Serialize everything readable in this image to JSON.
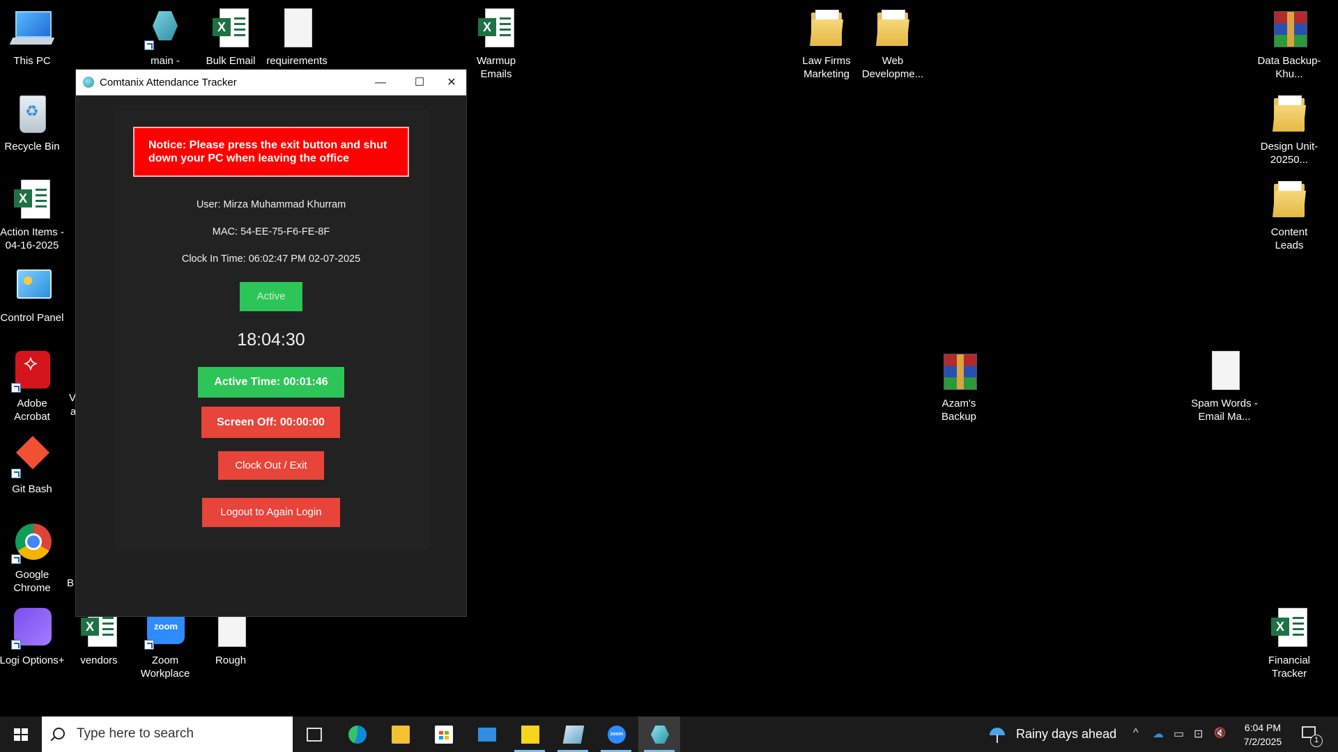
{
  "desktop": {
    "icons": [
      {
        "label": "This PC",
        "icon": "computer-icon"
      },
      {
        "label": "Recycle Bin",
        "icon": "recycle-bin-icon"
      },
      {
        "label": "Action Items - 04-16-2025",
        "icon": "excel-file-icon"
      },
      {
        "label": "Control Panel",
        "icon": "control-panel-icon"
      },
      {
        "label": "Adobe Acrobat",
        "icon": "acrobat-icon"
      },
      {
        "label": "Git Bash",
        "icon": "git-icon"
      },
      {
        "label": "Google Chrome",
        "icon": "chrome-icon"
      },
      {
        "label": "Logi Options+",
        "icon": "logi-icon"
      },
      {
        "label": "main - Shortcut",
        "icon": "app-shortcut-icon"
      },
      {
        "label": "Bulk Email Address",
        "icon": "excel-file-icon"
      },
      {
        "label": "requirements",
        "icon": "text-file-icon"
      },
      {
        "label": "vendors",
        "icon": "excel-file-icon"
      },
      {
        "label": "Zoom Workplace",
        "icon": "zoom-icon"
      },
      {
        "label": "Rough",
        "icon": "text-file-icon"
      },
      {
        "label": "Warmup Emails",
        "icon": "excel-file-icon"
      },
      {
        "label": "Law Firms Marketing",
        "icon": "folder-icon"
      },
      {
        "label": "Web Developme...",
        "icon": "folder-icon"
      },
      {
        "label": "Data Backup-Khu...",
        "icon": "archive-icon"
      },
      {
        "label": "Design Unit-20250...",
        "icon": "folder-icon"
      },
      {
        "label": "Content Leads",
        "icon": "folder-icon"
      },
      {
        "label": "Azam's Backup",
        "icon": "archive-icon"
      },
      {
        "label": "Spam Words - Email Ma...",
        "icon": "text-file-icon"
      },
      {
        "label": "Financial Tracker",
        "icon": "excel-file-icon"
      }
    ],
    "partial_labels": [
      "V",
      "a",
      "B"
    ]
  },
  "window": {
    "title": "Comtanix Attendance Tracker",
    "min_glyph": "—",
    "max_glyph": "☐",
    "close_glyph": "✕",
    "notice": "Notice: Please press the exit button and shut down your PC when leaving the office",
    "user": "User: Mirza Muhammad Khurram",
    "mac": "MAC: 54-EE-75-F6-FE-8F",
    "clock_in": "Clock In Time: 06:02:47 PM 02-07-2025",
    "status": "Active",
    "clock": "18:04:30",
    "active_time": "Active Time: 00:01:46",
    "screen_off": "Screen Off: 00:00:00",
    "clock_out_label": "Clock Out / Exit",
    "logout_label": "Logout to Again Login"
  },
  "taskbar": {
    "search_placeholder": "Type here to search",
    "weather": "Rainy days ahead",
    "time": "6:04 PM",
    "date": "7/2/2025",
    "notification_count": "1",
    "tray_glyphs": {
      "chevron": "^",
      "cloud": "☁",
      "battery": "▭",
      "network": "⊡",
      "volume": "🔇"
    }
  },
  "colors": {
    "notice_bg": "#ff0000",
    "active_green": "#2dc558",
    "danger_red": "#e8443a",
    "window_bg": "#202020"
  }
}
